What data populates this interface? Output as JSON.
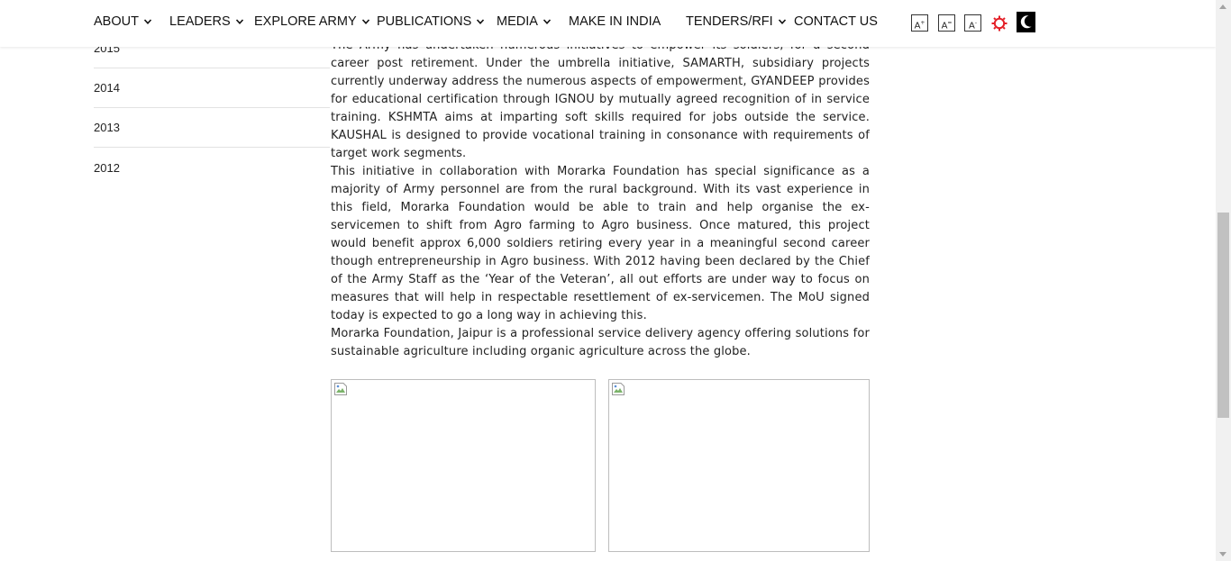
{
  "nav": {
    "items": [
      {
        "label": "ABOUT",
        "dropdown": true
      },
      {
        "label": "LEADERS",
        "dropdown": true
      },
      {
        "label": "EXPLORE ARMY",
        "dropdown": true
      },
      {
        "label": "PUBLICATIONS",
        "dropdown": true
      },
      {
        "label": "MEDIA",
        "dropdown": true
      },
      {
        "label": "MAKE IN INDIA",
        "dropdown": false
      },
      {
        "label": "TENDERS/RFI",
        "dropdown": true
      },
      {
        "label": "CONTACT US",
        "dropdown": false
      }
    ],
    "font_tools": [
      {
        "label": "A",
        "sup": "+",
        "icon": "increase-font-icon"
      },
      {
        "label": "A",
        "sup": "=",
        "icon": "reset-font-icon"
      },
      {
        "label": "A",
        "sup": "-",
        "icon": "decrease-font-icon"
      }
    ],
    "theme_icons": [
      "light-theme-icon",
      "dark-theme-icon"
    ],
    "accent_color": "#e41e26"
  },
  "sidebar": {
    "years": [
      "2015",
      "2014",
      "2013",
      "2012"
    ]
  },
  "article": {
    "paragraphs": [
      "The Army has undertaken numerous initiatives to empower its soldiers, for a second career post retirement. Under the umbrella initiative, SAMARTH, subsidiary projects currently underway address the numerous aspects of empowerment, GYANDEEP provides for educational certification through IGNOU by mutually agreed recognition of in service training. KSHMTA aims at imparting soft skills required for jobs outside the service. KAUSHAL is designed to provide vocational training in consonance with requirements of target work segments.",
      "This initiative in collaboration with Morarka Foundation has special significance as a majority of Army personnel are from the rural background. With its vast experience in this field, Morarka Foundation would be able to train and help organise the ex-servicemen to shift from Agro farming to Agro business. Once matured, this project would benefit approx 6,000 soldiers retiring every year in a meaningful second career though entrepreneurship in Agro business. With 2012 having been declared by the Chief of the Army Staff as the ‘Year of the Veteran’, all out efforts are under way to focus on measures that will help in respectable resettlement of ex-servicemen. The MoU signed today is expected to go a long way in achieving this.",
      "Morarka Foundation, Jaipur is a professional service delivery agency offering solutions for sustainable agriculture including organic agriculture across the globe."
    ],
    "images": [
      {
        "icon": "broken-image-icon"
      },
      {
        "icon": "broken-image-icon"
      }
    ]
  }
}
